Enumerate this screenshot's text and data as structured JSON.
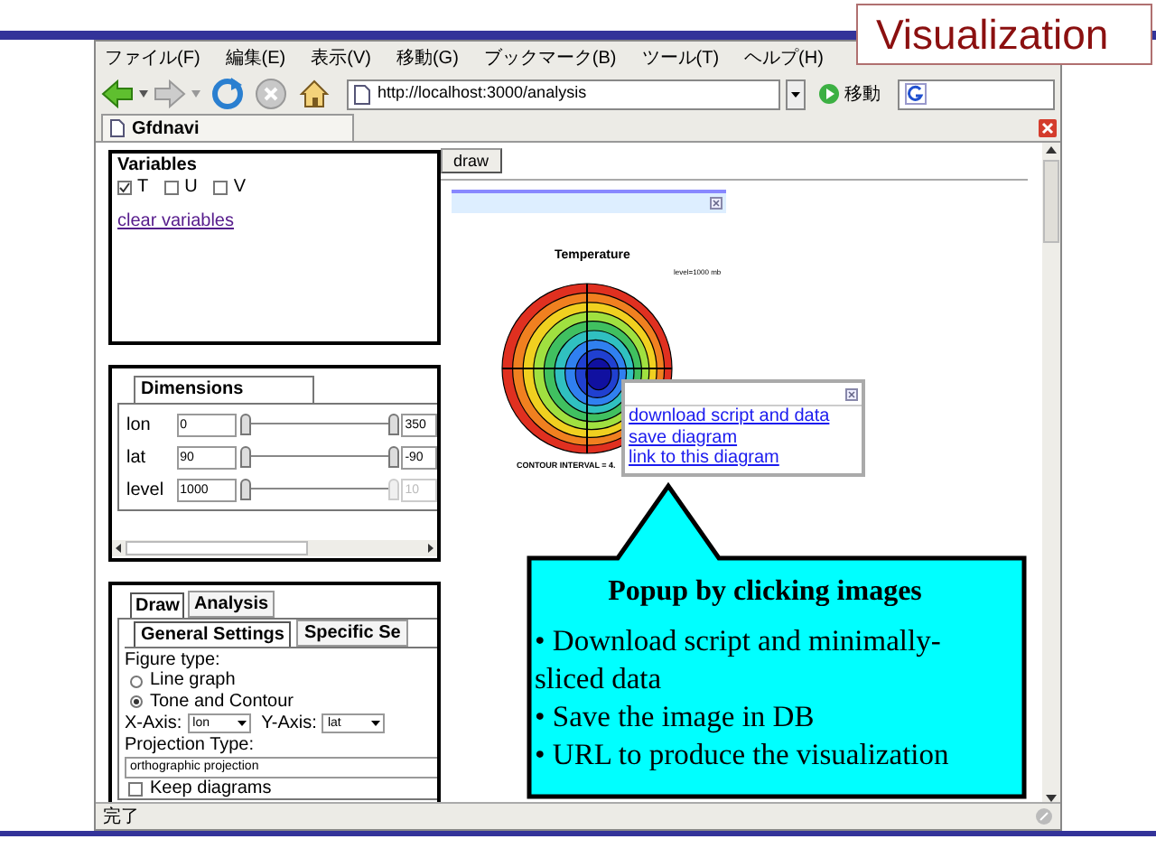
{
  "slide_title": "Visualization",
  "menu": [
    "ファイル(F)",
    "編集(E)",
    "表示(V)",
    "移動(G)",
    "ブックマーク(B)",
    "ツール(T)",
    "ヘルプ(H)"
  ],
  "toolbar": {
    "url": "http://localhost:3000/analysis",
    "go_label": "移動"
  },
  "tabs": [
    {
      "label": "Gfdnavi",
      "selected": true
    }
  ],
  "variables": {
    "title": "Variables",
    "items": [
      {
        "label": "T",
        "checked": true
      },
      {
        "label": "U",
        "checked": false
      },
      {
        "label": "V",
        "checked": false
      }
    ],
    "clear_link": "clear variables"
  },
  "draw_button": "draw",
  "dimensions": {
    "tab": "Dimensions",
    "rows": [
      {
        "name": "lon",
        "min": "0",
        "max": "350",
        "level": 1,
        "disabled": false
      },
      {
        "name": "lat",
        "min": "90",
        "max": "-90",
        "level": 1,
        "disabled": false
      },
      {
        "name": "level",
        "min": "1000",
        "max": "10",
        "level": 1,
        "disabled": true
      }
    ]
  },
  "draw_panel": {
    "tabs": [
      {
        "label": "Draw",
        "selected": true
      },
      {
        "label": "Analysis",
        "selected": false
      }
    ],
    "subtabs": [
      {
        "label": "General Settings",
        "selected": true
      },
      {
        "label": "Specific Se",
        "selected": false
      }
    ],
    "figure_type_label": "Figure type:",
    "figure_types": [
      {
        "label": "Line graph",
        "selected": false
      },
      {
        "label": "Tone and Contour",
        "selected": true
      }
    ],
    "x_axis_label": "X-Axis:",
    "x_axis": "lon",
    "y_axis_label": "Y-Axis:",
    "y_axis": "lat",
    "projection_label": "Projection Type:",
    "projection": "orthographic projection",
    "keep_diagrams": {
      "label": "Keep diagrams",
      "checked": false
    }
  },
  "figure": {
    "title": "Temperature",
    "level_note": "level=1000 mb",
    "contour_note": "CONTOUR INTERVAL = 4."
  },
  "popup": {
    "links": [
      "download script and data",
      "save diagram",
      "link to this diagram"
    ]
  },
  "callout": {
    "title": "Popup by clicking images",
    "bullets": [
      "• Download script and minimally-sliced data",
      "• Save the image in DB",
      "• URL to produce the visualization"
    ]
  },
  "status_bar": "完了"
}
